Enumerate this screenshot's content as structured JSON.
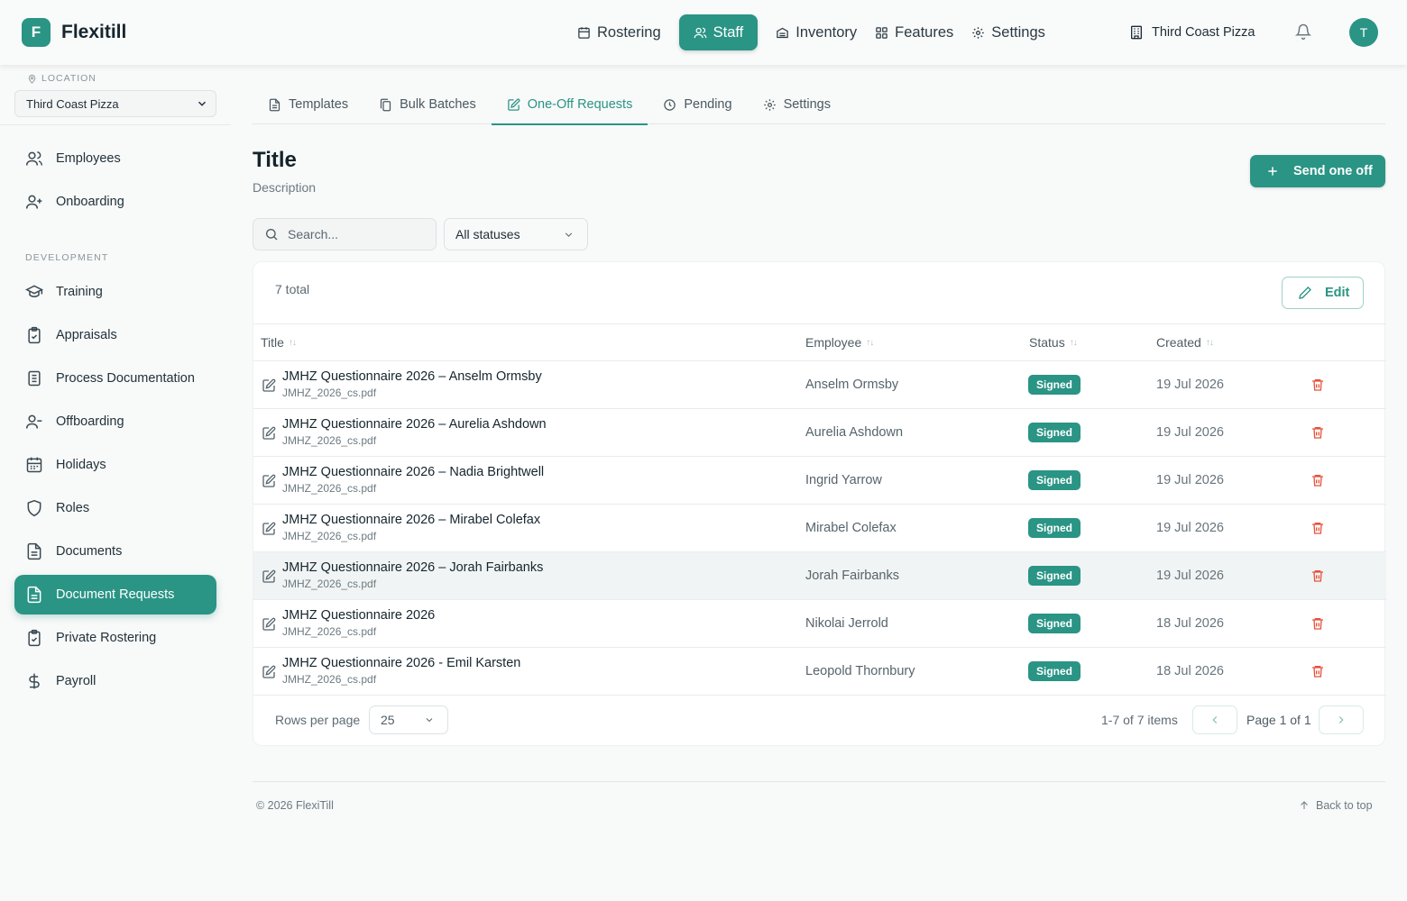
{
  "app": {
    "logo_letter": "F",
    "name": "Flexitill"
  },
  "topnav": [
    {
      "label": "Rostering",
      "icon": "calendar-icon"
    },
    {
      "label": "Staff",
      "icon": "users-icon",
      "active": true
    },
    {
      "label": "Inventory",
      "icon": "archive-icon"
    },
    {
      "label": "Features",
      "icon": "grid-icon"
    },
    {
      "label": "Settings",
      "icon": "gear-icon"
    }
  ],
  "store": {
    "label": "Third Coast Pizza",
    "icon": "building-icon"
  },
  "user": {
    "initial": "T"
  },
  "sidebar": {
    "location_label": "LOCATION",
    "location_value": "Third Coast Pizza",
    "section_development": "DEVELOPMENT",
    "items": [
      {
        "label": "Employees",
        "icon": "users-icon"
      },
      {
        "label": "Onboarding",
        "icon": "user-plus-icon"
      },
      {
        "label": "Training",
        "icon": "graduation-cap-icon"
      },
      {
        "label": "Appraisals",
        "icon": "clipboard-check-icon"
      },
      {
        "label": "Process Documentation",
        "icon": "document-list-icon"
      },
      {
        "label": "Offboarding",
        "icon": "user-minus-icon"
      },
      {
        "label": "Holidays",
        "icon": "calendar-days-icon"
      },
      {
        "label": "Roles",
        "icon": "shield-icon"
      },
      {
        "label": "Documents",
        "icon": "file-text-icon"
      },
      {
        "label": "Document Requests",
        "icon": "file-text-icon",
        "active": true
      },
      {
        "label": "Private Rostering",
        "icon": "clipboard-check-icon"
      },
      {
        "label": "Payroll",
        "icon": "dollar-icon"
      }
    ]
  },
  "tabs": [
    {
      "label": "Templates",
      "icon": "file-icon"
    },
    {
      "label": "Bulk Batches",
      "icon": "copy-icon"
    },
    {
      "label": "One-Off Requests",
      "icon": "edit-icon",
      "active": true
    },
    {
      "label": "Pending",
      "icon": "clock-icon"
    },
    {
      "label": "Settings",
      "icon": "gear-icon"
    }
  ],
  "page": {
    "title": "Title",
    "description": "Description",
    "primary_button": "Send one off"
  },
  "filters": {
    "search_placeholder": "Search...",
    "status_value": "All statuses"
  },
  "table": {
    "total": "7 total",
    "edit_label": "Edit",
    "columns": {
      "title": "Title",
      "employee": "Employee",
      "status": "Status",
      "created": "Created"
    },
    "rows": [
      {
        "title": "JMHZ Questionnaire 2026 – Anselm Ormsby",
        "file": "JMHZ_2026_cs.pdf",
        "employee": "Anselm Ormsby",
        "status": "Signed",
        "created": "19 Jul 2026"
      },
      {
        "title": "JMHZ Questionnaire 2026 – Aurelia Ashdown",
        "file": "JMHZ_2026_cs.pdf",
        "employee": "Aurelia Ashdown",
        "status": "Signed",
        "created": "19 Jul 2026"
      },
      {
        "title": "JMHZ Questionnaire 2026 – Nadia Brightwell",
        "file": "JMHZ_2026_cs.pdf",
        "employee": "Ingrid Yarrow",
        "status": "Signed",
        "created": "19 Jul 2026"
      },
      {
        "title": "JMHZ Questionnaire 2026 – Mirabel Colefax",
        "file": "JMHZ_2026_cs.pdf",
        "employee": "Mirabel Colefax",
        "status": "Signed",
        "created": "19 Jul 2026"
      },
      {
        "title": "JMHZ Questionnaire 2026 – Jorah Fairbanks",
        "file": "JMHZ_2026_cs.pdf",
        "employee": "Jorah Fairbanks",
        "status": "Signed",
        "created": "19 Jul 2026"
      },
      {
        "title": "JMHZ Questionnaire 2026",
        "file": "JMHZ_2026_cs.pdf",
        "employee": "Nikolai Jerrold",
        "status": "Signed",
        "created": "18 Jul 2026"
      },
      {
        "title": "JMHZ Questionnaire 2026 - Emil Karsten",
        "file": "JMHZ_2026_cs.pdf",
        "employee": "Leopold Thornbury",
        "status": "Signed",
        "created": "18 Jul 2026"
      }
    ],
    "rows_per_page_label": "Rows per page",
    "rows_per_page_value": "25",
    "items_info": "1-7 of 7 items",
    "page_info": "Page 1 of 1"
  },
  "footer": {
    "copyright": "© 2026 FlexiTill",
    "back_to_top": "Back to top"
  },
  "colors": {
    "accent": "#2a9485",
    "danger": "#e5533d"
  }
}
